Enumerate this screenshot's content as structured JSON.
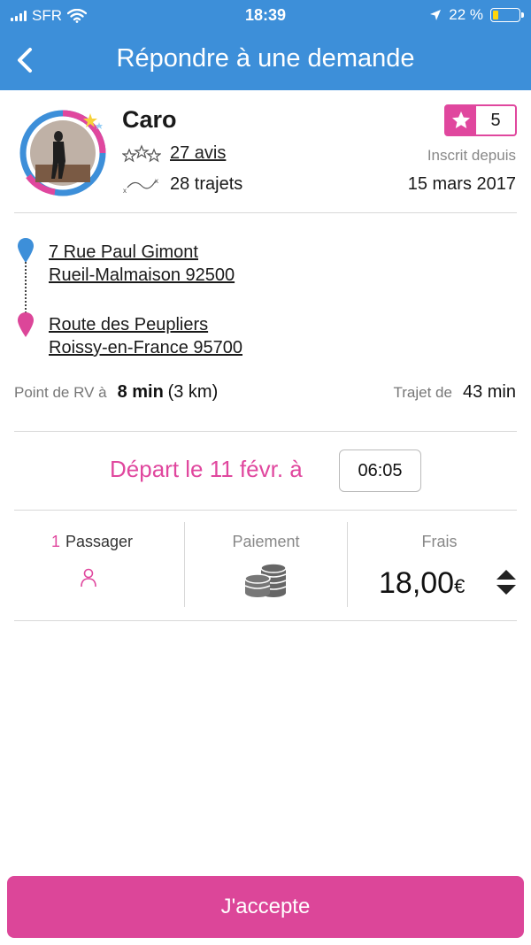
{
  "status_bar": {
    "carrier": "SFR",
    "time": "18:39",
    "battery": "22 %",
    "battery_level": 0.22
  },
  "nav": {
    "title": "Répondre à une demande"
  },
  "profile": {
    "name": "Caro",
    "rating": "5",
    "reviews": "27 avis",
    "trips": "28 trajets",
    "member_since_label": "Inscrit depuis",
    "member_since_date": "15 mars 2017"
  },
  "route": {
    "from_line1": "7 Rue Paul Gimont",
    "from_line2": "Rueil-Malmaison 92500",
    "to_line1": "Route des Peupliers",
    "to_line2": "Roissy-en-France 95700",
    "meet_label": "Point de RV à",
    "meet_time": "8 min",
    "meet_distance": "(3 km)",
    "trip_label": "Trajet de",
    "trip_time": "43 min"
  },
  "departure": {
    "label": "Départ le 11 févr. à",
    "time": "06:05"
  },
  "details": {
    "passenger_count": "1",
    "passenger_label": "Passager",
    "payment_label": "Paiement",
    "fees_label": "Frais",
    "price": "18,00",
    "currency": "€"
  },
  "colors": {
    "primary": "#3d8fd9",
    "accent": "#e0479e"
  },
  "accept_label": "J'accepte"
}
